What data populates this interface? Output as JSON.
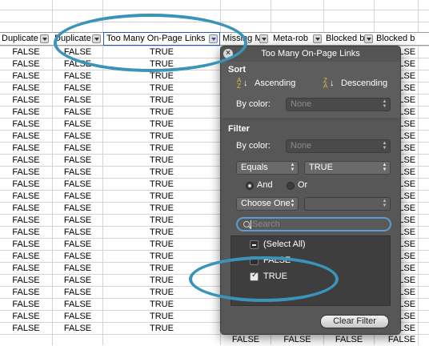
{
  "spreadsheet": {
    "headers": [
      "Duplicate",
      "Duplicate",
      "Too Many On-Page Links",
      "Missing M",
      "Meta-rob",
      "Blocked b",
      "Blocked b"
    ],
    "col_a": [
      "FALSE",
      "FALSE",
      "FALSE",
      "FALSE",
      "FALSE",
      "FALSE",
      "FALSE",
      "FALSE",
      "FALSE",
      "FALSE",
      "FALSE",
      "FALSE",
      "FALSE",
      "FALSE",
      "FALSE",
      "FALSE",
      "FALSE",
      "FALSE",
      "FALSE",
      "FALSE",
      "FALSE",
      "FALSE",
      "FALSE",
      "FALSE"
    ],
    "col_b": [
      "FALSE",
      "FALSE",
      "FALSE",
      "FALSE",
      "FALSE",
      "FALSE",
      "FALSE",
      "FALSE",
      "FALSE",
      "FALSE",
      "FALSE",
      "FALSE",
      "FALSE",
      "FALSE",
      "FALSE",
      "FALSE",
      "FALSE",
      "FALSE",
      "FALSE",
      "FALSE",
      "FALSE",
      "FALSE",
      "FALSE",
      "FALSE"
    ],
    "col_c": [
      "TRUE",
      "TRUE",
      "TRUE",
      "TRUE",
      "TRUE",
      "TRUE",
      "TRUE",
      "TRUE",
      "TRUE",
      "TRUE",
      "TRUE",
      "TRUE",
      "TRUE",
      "TRUE",
      "TRUE",
      "TRUE",
      "TRUE",
      "TRUE",
      "TRUE",
      "TRUE",
      "TRUE",
      "TRUE",
      "TRUE",
      "TRUE"
    ],
    "col_g": [
      "FALSE",
      "FALSE",
      "FALSE",
      "FALSE",
      "FALSE",
      "FALSE",
      "FALSE",
      "FALSE",
      "FALSE",
      "FALSE",
      "FALSE",
      "FALSE",
      "FALSE",
      "FALSE",
      "FALSE",
      "FALSE",
      "FALSE",
      "FALSE",
      "FALSE",
      "FALSE",
      "FALSE",
      "FALSE",
      "FALSE",
      "FALSE"
    ],
    "bottom_row": [
      "FALSE",
      "FALSE",
      "FALSE",
      "FALSE"
    ]
  },
  "popup": {
    "title": "Too Many On-Page Links",
    "close_glyph": "×",
    "sort": {
      "heading": "Sort",
      "ascending": "Ascending",
      "descending": "Descending",
      "by_color_label": "By color:",
      "by_color_value": "None"
    },
    "filter": {
      "heading": "Filter",
      "by_color_label": "By color:",
      "by_color_value": "None",
      "operator": "Equals",
      "value": "TRUE",
      "and_label": "And",
      "or_label": "Or",
      "second_operator": "Choose One",
      "second_value": ""
    },
    "search": {
      "placeholder": "Search"
    },
    "list": {
      "select_all": "(Select All)",
      "items": [
        "FALSE",
        "TRUE"
      ]
    },
    "clear_button": "Clear Filter"
  },
  "colors": {
    "annotation": "#3a93b8",
    "popup_bg": "#545454",
    "active_header_border": "#2a55b8",
    "search_focus": "#5b9bd5"
  }
}
